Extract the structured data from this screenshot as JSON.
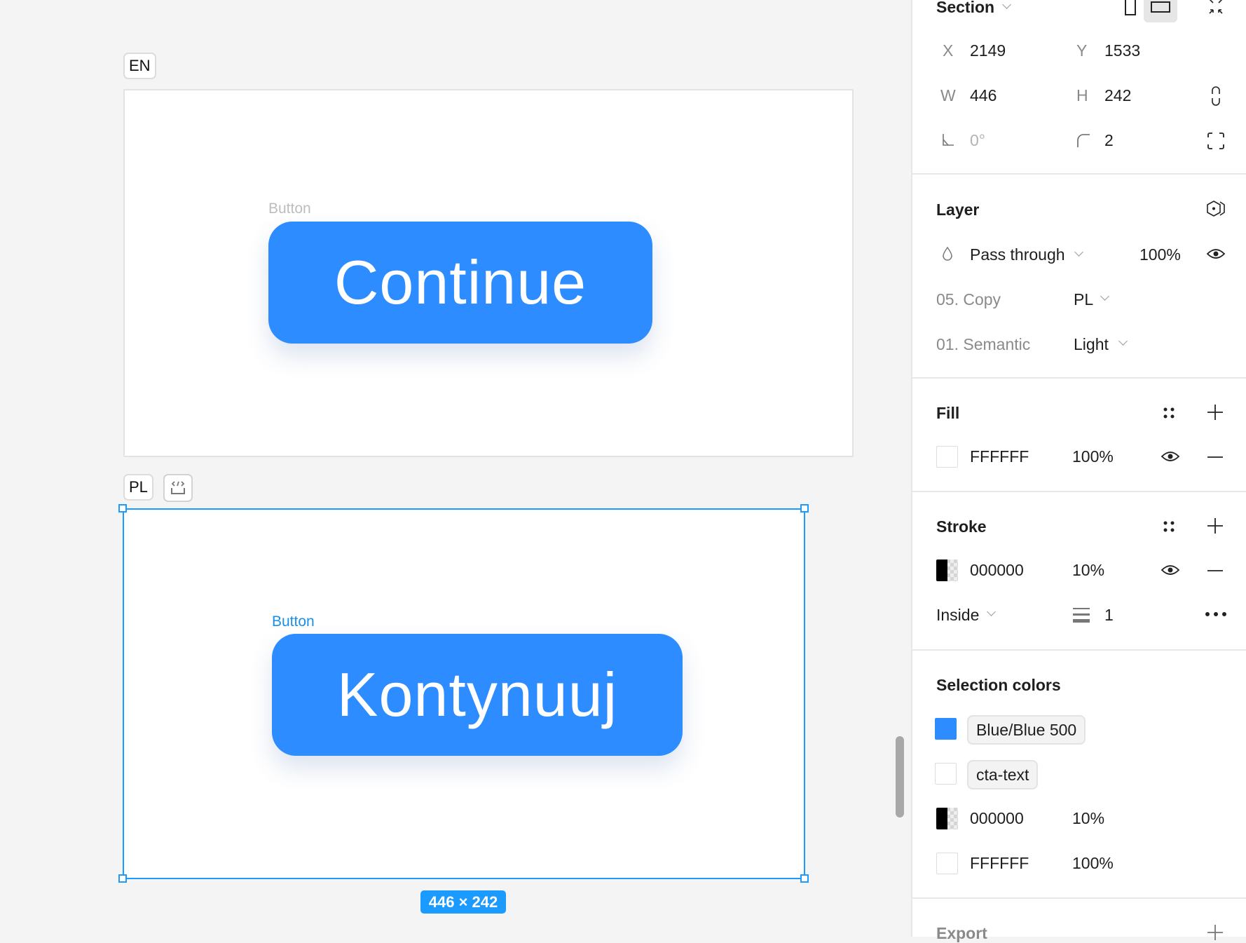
{
  "canvas": {
    "frame_en": {
      "lang_badge": "EN",
      "component_label": "Button",
      "button_text": "Continue"
    },
    "frame_pl": {
      "lang_badge": "PL",
      "code_icon": "code-snippet-icon",
      "component_label": "Button",
      "button_text": "Kontynuuj",
      "size_badge": "446 × 242"
    },
    "colors": {
      "cta_blue": "#2D8CFF",
      "selection_blue": "#1B9AFF"
    }
  },
  "panel": {
    "section": {
      "title": "Section",
      "x_label": "X",
      "x": "2149",
      "y_label": "Y",
      "y": "1533",
      "w_label": "W",
      "w": "446",
      "h_label": "H",
      "h": "242",
      "rotation": "0°",
      "corner_radius": "2"
    },
    "layer": {
      "title": "Layer",
      "blend_mode": "Pass through",
      "opacity": "100%",
      "modes": [
        {
          "collection": "05. Copy",
          "value": "PL"
        },
        {
          "collection": "01. Semantic",
          "value": "Light"
        }
      ]
    },
    "fill": {
      "title": "Fill",
      "items": [
        {
          "hex": "FFFFFF",
          "opacity": "100%",
          "color": "#FFFFFF"
        }
      ]
    },
    "stroke": {
      "title": "Stroke",
      "items": [
        {
          "hex": "000000",
          "opacity": "10%",
          "color": "#000000"
        }
      ],
      "position": "Inside",
      "weight": "1"
    },
    "selection_colors": {
      "title": "Selection colors",
      "items": [
        {
          "label": "Blue/Blue 500",
          "color": "#2D8CFF"
        },
        {
          "label": "cta-text",
          "color": "#FFFFFF"
        },
        {
          "hex": "000000",
          "opacity": "10%",
          "color": "#000000"
        },
        {
          "hex": "FFFFFF",
          "opacity": "100%",
          "color": "#FFFFFF"
        }
      ]
    },
    "export": {
      "title": "Export"
    }
  }
}
